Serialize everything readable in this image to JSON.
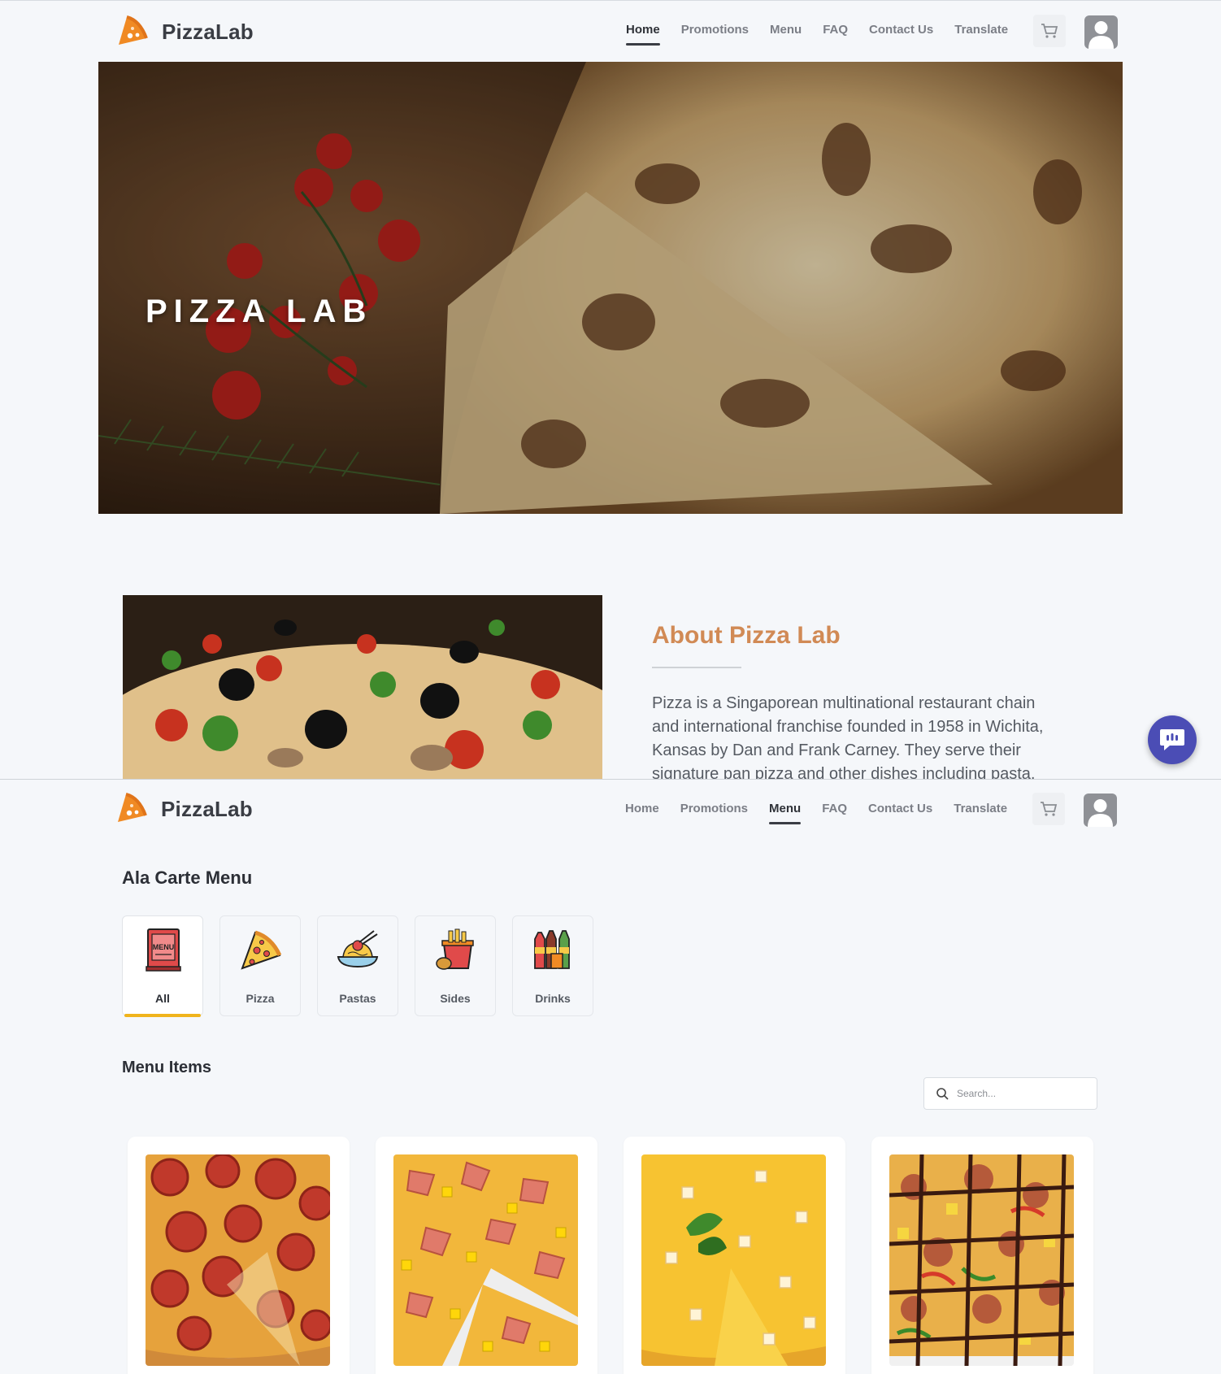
{
  "brand": {
    "name": "PizzaLab",
    "color": "#f08a24"
  },
  "nav": {
    "home": "Home",
    "promotions": "Promotions",
    "menu": "Menu",
    "faq": "FAQ",
    "contact": "Contact Us",
    "translate": "Translate"
  },
  "hero": {
    "title": "PIZZA LAB"
  },
  "about": {
    "title": "About Pizza Lab",
    "text": "Pizza  is a Singaporean multinational restaurant chain and international franchise founded in 1958 in Wichita, Kansas by Dan and Frank Carney. They serve their signature pan pizza and other dishes including pasta,"
  },
  "menu_page": {
    "ala_carte_title": "Ala Carte Menu",
    "categories": [
      {
        "label": "All",
        "icon": "menu-book-icon",
        "active": true
      },
      {
        "label": "Pizza",
        "icon": "pizza-slice-icon",
        "active": false
      },
      {
        "label": "Pastas",
        "icon": "pasta-bowl-icon",
        "active": false
      },
      {
        "label": "Sides",
        "icon": "sides-bucket-icon",
        "active": false
      },
      {
        "label": "Drinks",
        "icon": "drink-bottles-icon",
        "active": false
      }
    ],
    "items_title": "Menu Items",
    "search_placeholder": "Search..."
  },
  "colors": {
    "accent": "#f0b41c",
    "about_title": "#d18a55",
    "chat": "#4b4db5"
  }
}
